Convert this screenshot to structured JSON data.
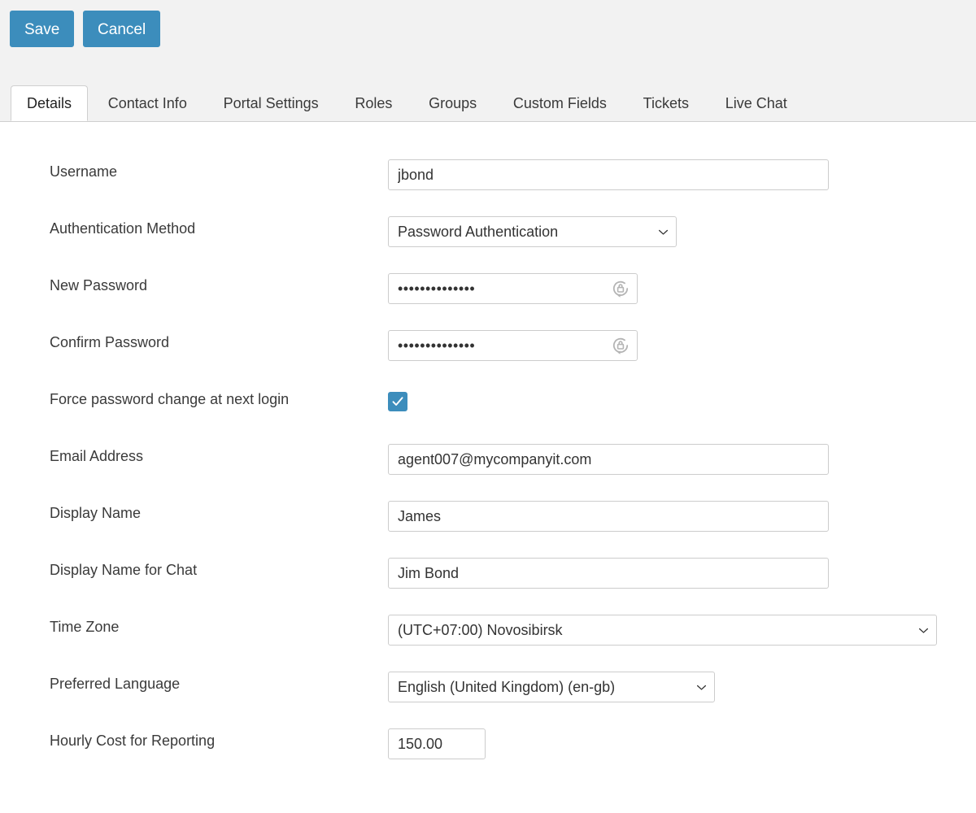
{
  "toolbar": {
    "save_label": "Save",
    "cancel_label": "Cancel"
  },
  "tabs": [
    {
      "label": "Details",
      "active": true
    },
    {
      "label": "Contact Info",
      "active": false
    },
    {
      "label": "Portal Settings",
      "active": false
    },
    {
      "label": "Roles",
      "active": false
    },
    {
      "label": "Groups",
      "active": false
    },
    {
      "label": "Custom Fields",
      "active": false
    },
    {
      "label": "Tickets",
      "active": false
    },
    {
      "label": "Live Chat",
      "active": false
    }
  ],
  "form": {
    "username": {
      "label": "Username",
      "value": "jbond"
    },
    "auth_method": {
      "label": "Authentication Method",
      "value": "Password Authentication"
    },
    "new_password": {
      "label": "New Password",
      "value": "••••••••••••••"
    },
    "confirm_password": {
      "label": "Confirm Password",
      "value": "••••••••••••••"
    },
    "force_change": {
      "label": "Force password change at next login",
      "checked": true
    },
    "email": {
      "label": "Email Address",
      "value": "agent007@mycompanyit.com"
    },
    "display_name": {
      "label": "Display Name",
      "value": "James"
    },
    "display_name_chat": {
      "label": "Display Name for Chat",
      "value": "Jim Bond"
    },
    "time_zone": {
      "label": "Time Zone",
      "value": "(UTC+07:00) Novosibirsk"
    },
    "language": {
      "label": "Preferred Language",
      "value": "English (United Kingdom) (en-gb)"
    },
    "hourly_cost": {
      "label": "Hourly Cost for Reporting",
      "value": "150.00"
    }
  },
  "colors": {
    "accent": "#3c8dbc",
    "toolbar_bg": "#f2f2f2",
    "border": "#cccccc",
    "text": "#3a3a3a"
  },
  "icons": {
    "generate_password": "generate-password-icon",
    "chevron": "chevron-down-icon",
    "check": "check-icon"
  }
}
